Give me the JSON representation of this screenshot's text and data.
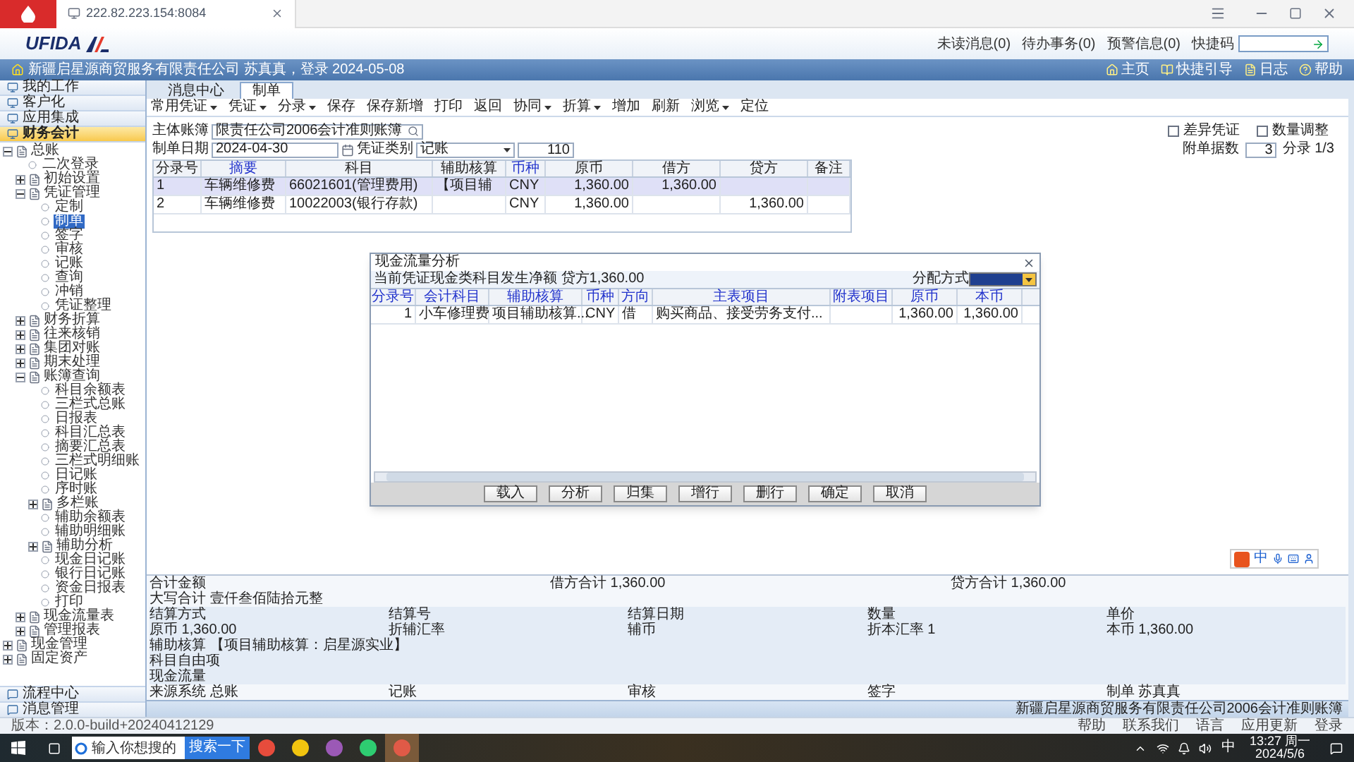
{
  "browser": {
    "tab_title": "222.82.223.154:8084"
  },
  "header": {
    "logo": "UFIDA",
    "links": [
      "未读消息(0)",
      "待办事务(0)",
      "预警信息(0)"
    ],
    "quick_code_label": "快捷码"
  },
  "info_bar": {
    "text": "新疆启星源商贸服务有限责任公司 苏真真，登录 2024-05-08",
    "links": [
      "主页",
      "快捷引导",
      "日志",
      "帮助"
    ]
  },
  "sidebar": {
    "nav": [
      {
        "label": "我的工作",
        "selected": false
      },
      {
        "label": "客户化",
        "selected": false
      },
      {
        "label": "应用集成",
        "selected": false
      },
      {
        "label": "财务会计",
        "selected": true
      }
    ],
    "tree": [
      {
        "label": "总账",
        "kind": "folder",
        "expanded": true,
        "children": [
          {
            "label": "二次登录",
            "kind": "leaf",
            "selected": false
          },
          {
            "label": "初始设置",
            "kind": "folder",
            "expanded": false
          },
          {
            "label": "凭证管理",
            "kind": "folder",
            "expanded": true,
            "children": [
              {
                "label": "定制",
                "kind": "leaf",
                "selected": false
              },
              {
                "label": "制单",
                "kind": "leaf",
                "selected": true
              },
              {
                "label": "签字",
                "kind": "leaf",
                "selected": false
              },
              {
                "label": "审核",
                "kind": "leaf",
                "selected": false
              },
              {
                "label": "记账",
                "kind": "leaf",
                "selected": false
              },
              {
                "label": "查询",
                "kind": "leaf",
                "selected": false
              },
              {
                "label": "冲销",
                "kind": "leaf",
                "selected": false
              },
              {
                "label": "凭证整理",
                "kind": "leaf",
                "selected": false
              }
            ]
          },
          {
            "label": "财务折算",
            "kind": "folder",
            "expanded": false
          },
          {
            "label": "往来核销",
            "kind": "folder",
            "expanded": false
          },
          {
            "label": "集团对账",
            "kind": "folder",
            "expanded": false
          },
          {
            "label": "期末处理",
            "kind": "folder",
            "expanded": false
          },
          {
            "label": "账簿查询",
            "kind": "folder",
            "expanded": true,
            "children": [
              {
                "label": "科目余额表",
                "kind": "leaf",
                "selected": false
              },
              {
                "label": "三栏式总账",
                "kind": "leaf",
                "selected": false
              },
              {
                "label": "日报表",
                "kind": "leaf",
                "selected": false
              },
              {
                "label": "科目汇总表",
                "kind": "leaf",
                "selected": false
              },
              {
                "label": "摘要汇总表",
                "kind": "leaf",
                "selected": false
              },
              {
                "label": "三栏式明细账",
                "kind": "leaf",
                "selected": false
              },
              {
                "label": "日记账",
                "kind": "leaf",
                "selected": false
              },
              {
                "label": "序时账",
                "kind": "leaf",
                "selected": false
              },
              {
                "label": "多栏账",
                "kind": "folder",
                "expanded": false
              },
              {
                "label": "辅助余额表",
                "kind": "leaf",
                "selected": false
              },
              {
                "label": "辅助明细账",
                "kind": "leaf",
                "selected": false
              },
              {
                "label": "辅助分析",
                "kind": "folder",
                "expanded": false
              },
              {
                "label": "现金日记账",
                "kind": "leaf",
                "selected": false
              },
              {
                "label": "银行日记账",
                "kind": "leaf",
                "selected": false
              },
              {
                "label": "资金日报表",
                "kind": "leaf",
                "selected": false
              },
              {
                "label": "打印",
                "kind": "leaf",
                "selected": false
              }
            ]
          },
          {
            "label": "现金流量表",
            "kind": "folder",
            "expanded": false
          },
          {
            "label": "管理报表",
            "kind": "folder",
            "expanded": false
          }
        ]
      },
      {
        "label": "现金管理",
        "kind": "folder",
        "expanded": false
      },
      {
        "label": "固定资产",
        "kind": "folder",
        "expanded": false
      }
    ],
    "bottom": [
      {
        "label": "流程中心"
      },
      {
        "label": "消息管理"
      }
    ]
  },
  "tabs": [
    {
      "label": "消息中心",
      "selected": false
    },
    {
      "label": "制单",
      "selected": true
    }
  ],
  "toolbar": [
    {
      "label": "常用凭证",
      "has_menu": true
    },
    {
      "label": "凭证",
      "has_menu": true
    },
    {
      "label": "分录",
      "has_menu": true
    },
    {
      "label": "保存",
      "has_menu": false
    },
    {
      "label": "保存新增",
      "has_menu": false
    },
    {
      "label": "打印",
      "has_menu": false
    },
    {
      "label": "返回",
      "has_menu": false
    },
    {
      "label": "协同",
      "has_menu": true
    },
    {
      "label": "折算",
      "has_menu": true
    },
    {
      "label": "增加",
      "has_menu": false
    },
    {
      "label": "刷新",
      "has_menu": false
    },
    {
      "label": "浏览",
      "has_menu": true
    },
    {
      "label": "定位",
      "has_menu": false
    }
  ],
  "form": {
    "book_label": "主体账簿",
    "book_value": "限责任公司2006会计准则账簿",
    "date_label": "制单日期",
    "date_value": "2024-04-30",
    "type_label": "凭证类别",
    "type_value": "记账",
    "number_value": "110",
    "checks": [
      {
        "label": "差异凭证",
        "checked": false
      },
      {
        "label": "数量调整",
        "checked": false
      }
    ],
    "attachments_label": "附单据数",
    "attachments_value": "3",
    "entry_counter": "分录 1/3"
  },
  "voucher_table": {
    "columns": [
      "分录号",
      "摘要",
      "科目",
      "辅助核算",
      "币种",
      "原币",
      "借方",
      "贷方",
      "备注"
    ],
    "rows": [
      {
        "selected": true,
        "cells": [
          "1",
          "车辆维修费",
          "66021601(管理费用)",
          "【项目辅",
          "CNY",
          "1,360.00",
          "1,360.00",
          "",
          ""
        ]
      },
      {
        "selected": false,
        "cells": [
          "2",
          "车辆维修费",
          "10022003(银行存款)",
          "",
          "CNY",
          "1,360.00",
          "",
          "1,360.00",
          ""
        ]
      }
    ]
  },
  "summary": {
    "total_label": "合计金额",
    "debit_label": "借方合计",
    "debit": "1,360.00",
    "credit_label": "贷方合计",
    "credit": "1,360.00",
    "words_label": "大写合计",
    "words": "壹仟叁佰陆拾元整",
    "details": [
      [
        "结算方式",
        "结算号",
        "结算日期",
        "数量",
        "单价"
      ],
      [
        "原币 1,360.00",
        "折辅汇率",
        "辅币",
        "折本汇率 1",
        "本币 1,360.00"
      ]
    ],
    "lines": [
      "辅助核算 【项目辅助核算：启星源实业】",
      "科目自由项",
      "现金流量"
    ],
    "signatures": [
      "来源系统 总账",
      "记账",
      "审核",
      "签字",
      "制单 苏真真"
    ]
  },
  "status_bar": "新疆启星源商贸服务有限责任公司2006会计准则账簿",
  "dialog": {
    "title": "现金流量分析",
    "info": "当前凭证现金类科目发生净额 贷方1,360.00",
    "mode_label": "分配方式",
    "columns": [
      "分录号",
      "会计科目",
      "辅助核算",
      "币种",
      "方向",
      "主表项目",
      "附表项目",
      "原币",
      "本币"
    ],
    "rows": [
      [
        "1",
        "小车修理费",
        "项目辅助核算...",
        "CNY",
        "借",
        "购买商品、接受劳务支付...",
        "",
        "1,360.00",
        "1,360.00"
      ]
    ],
    "buttons": [
      "载入",
      "分析",
      "归集",
      "增行",
      "删行",
      "确定",
      "取消"
    ]
  },
  "footer": {
    "version": "版本：2.0.0-build+20240412129",
    "links": [
      "帮助",
      "联系我们",
      "语言",
      "应用更新",
      "登录"
    ]
  },
  "taskbar": {
    "search_placeholder": "输入你想搜的",
    "search_button": "搜索一下",
    "ime": "中",
    "time": "13:27 周一",
    "date": "2024/5/6"
  },
  "ime_bar": {
    "label": "中"
  }
}
